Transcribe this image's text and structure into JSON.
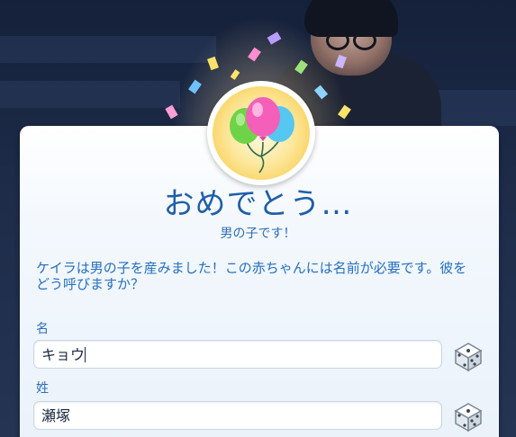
{
  "dialog": {
    "title": "おめでとう…",
    "subtitle": "男の子です！",
    "message": "ケイラは男の子を産みました！この赤ちゃんには名前が必要です。彼をどう呼びますか？"
  },
  "badge": {
    "icon": "balloons-icon"
  },
  "fields": {
    "first_name": {
      "label": "名",
      "value": "キョウ"
    },
    "last_name": {
      "label": "姓",
      "value": "瀬塚"
    }
  },
  "colors": {
    "accent": "#1f5fa8",
    "text_blue": "#2470c0",
    "badge_gold": "#f7cf55"
  }
}
